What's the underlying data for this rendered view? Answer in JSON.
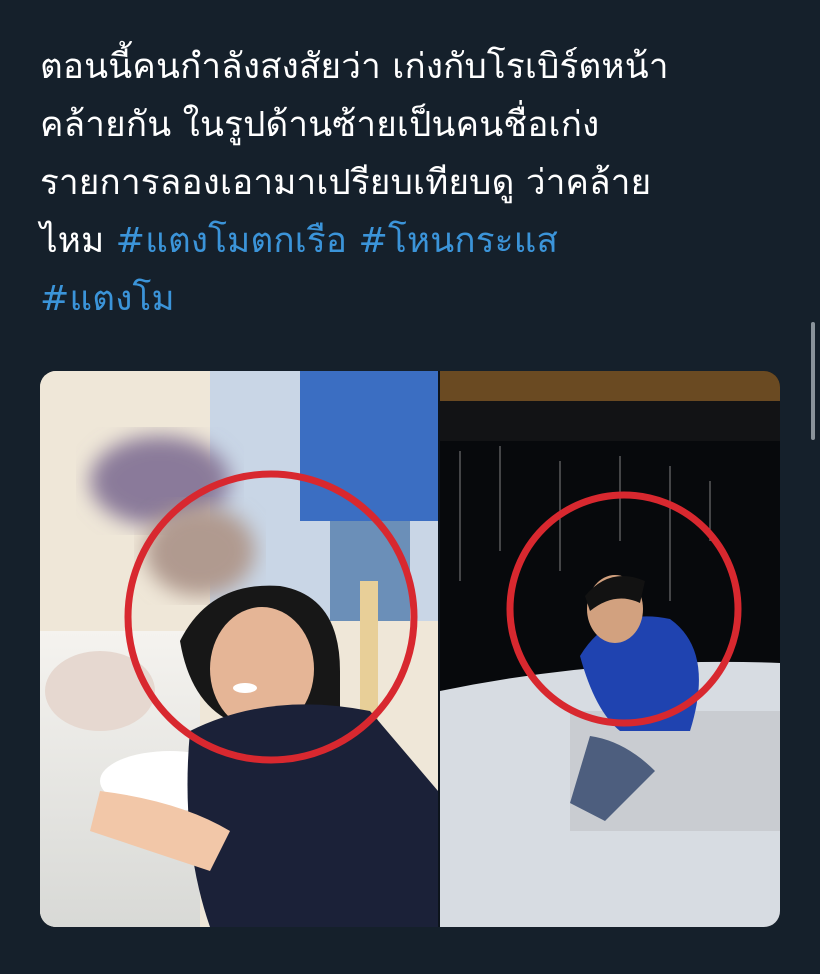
{
  "tweet": {
    "line1": "ตอนนี้คนกำลังสงสัยว่า เก่งกับโรเบิร์ตหน้า",
    "line2": "คล้ายกัน  ในรูปด้านซ้ายเป็นคนชื่อเก่ง",
    "line3": "รายการลองเอามาเปรียบเทียบดู ว่าคล้าย",
    "line4_prefix": "ไหม ",
    "hashtags": [
      "#แตงโมตกเรือ",
      "#โหนกระแส",
      "#แตงโม"
    ]
  },
  "media": {
    "left_photo": "restaurant-photo-red-circle",
    "right_photo": "boat-photo-red-circle"
  },
  "colors": {
    "background": "#15202b",
    "text": "#ffffff",
    "hashtag": "#3b94d9",
    "circle": "#d8282f"
  }
}
